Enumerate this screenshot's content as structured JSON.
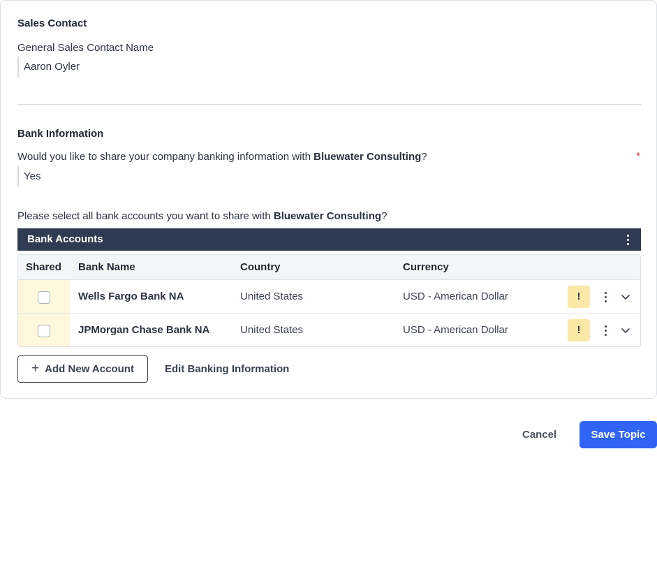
{
  "sales_contact": {
    "section_title": "Sales Contact",
    "name_label": "General Sales Contact Name",
    "name_value": "Aaron Oyler"
  },
  "bank_info": {
    "section_title": "Bank Information",
    "share_question_prefix": "Would you like to share your company banking information with ",
    "company": "Bluewater Consulting",
    "question_suffix": "?",
    "required_mark": "*",
    "share_answer": "Yes",
    "select_prompt_prefix": "Please select all bank accounts you want to share with "
  },
  "bank_accounts": {
    "title": "Bank Accounts",
    "columns": {
      "shared": "Shared",
      "bank_name": "Bank Name",
      "country": "Country",
      "currency": "Currency"
    },
    "rows": [
      {
        "bank_name": "Wells Fargo Bank NA",
        "country": "United States",
        "currency": "USD - American Dollar",
        "warning": "!",
        "shared": false
      },
      {
        "bank_name": "JPMorgan Chase Bank NA",
        "country": "United States",
        "currency": "USD - American Dollar",
        "warning": "!",
        "shared": false
      }
    ]
  },
  "actions": {
    "add_account": "Add New Account",
    "add_icon": "+",
    "edit_banking": "Edit Banking Information",
    "cancel": "Cancel",
    "save": "Save Topic"
  },
  "icons": {
    "header_menu": "kebab-icon",
    "row_menu": "kebab-icon",
    "row_expand": "chevron-down-icon",
    "add": "plus-icon"
  },
  "colors": {
    "grid_header_bg": "#2e3b52",
    "primary": "#2f64f5",
    "warning_bg": "#fbe8a6",
    "shared_cell_bg": "#fdf7dc",
    "required": "#e0342f"
  }
}
